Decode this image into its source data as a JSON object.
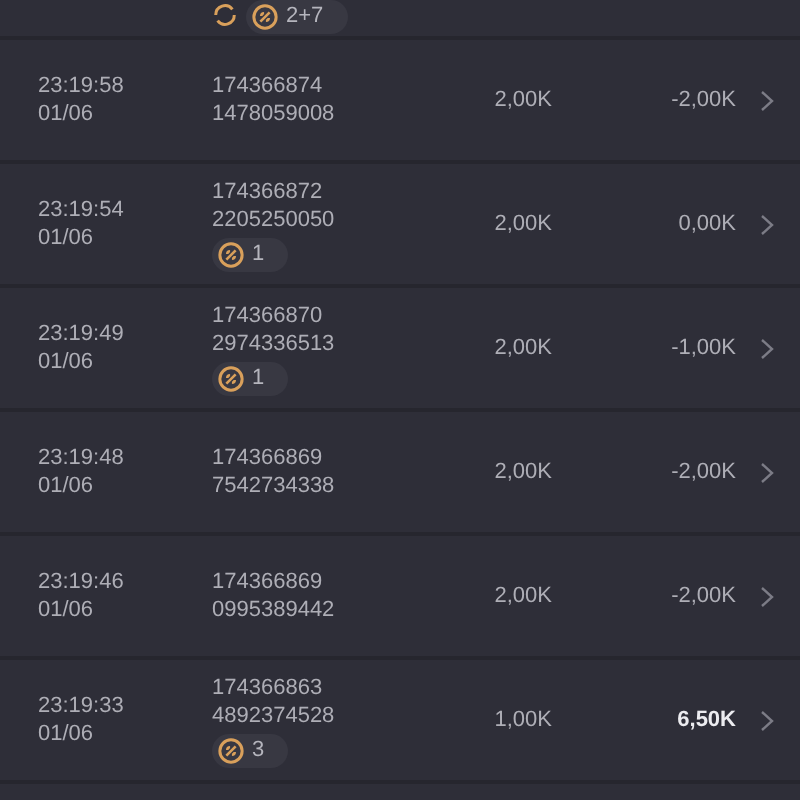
{
  "top_row": {
    "refresh_icon": true,
    "badge": "2+7"
  },
  "rows": [
    {
      "time": "23:19:58",
      "date": "01/06",
      "id": "174366874",
      "number": "1478059008",
      "amount": "2,00K",
      "result": "-2,00K",
      "positive": false
    },
    {
      "time": "23:19:54",
      "date": "01/06",
      "id": "174366872",
      "number": "2205250050",
      "badge": "1",
      "amount": "2,00K",
      "result": "0,00K",
      "positive": false
    },
    {
      "time": "23:19:49",
      "date": "01/06",
      "id": "174366870",
      "number": "2974336513",
      "badge": "1",
      "amount": "2,00K",
      "result": "-1,00K",
      "positive": false
    },
    {
      "time": "23:19:48",
      "date": "01/06",
      "id": "174366869",
      "number": "7542734338",
      "amount": "2,00K",
      "result": "-2,00K",
      "positive": false
    },
    {
      "time": "23:19:46",
      "date": "01/06",
      "id": "174366869",
      "number": "0995389442",
      "amount": "2,00K",
      "result": "-2,00K",
      "positive": false
    },
    {
      "time": "23:19:33",
      "date": "01/06",
      "id": "174366863",
      "number": "4892374528",
      "badge": "3",
      "amount": "1,00K",
      "result": "6,50K",
      "positive": true
    }
  ]
}
